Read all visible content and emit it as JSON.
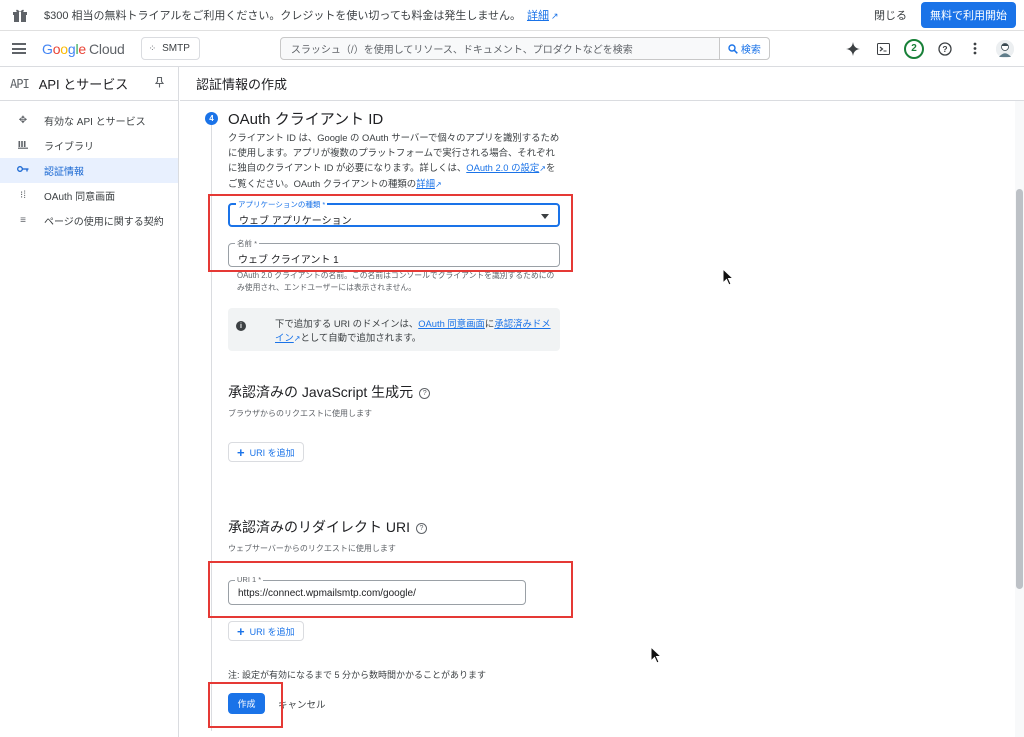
{
  "banner": {
    "message": "$300 相当の無料トライアルをご利用ください。クレジットを使い切っても料金は発生しません。",
    "detail_link": "詳細",
    "close": "閉じる",
    "trial_button": "無料で利用開始"
  },
  "header": {
    "logo_google": [
      "G",
      "o",
      "o",
      "g",
      "l",
      "e"
    ],
    "logo_cloud": "Cloud",
    "project": "SMTP",
    "search_placeholder": "スラッシュ（/）を使用してリソース、ドキュメント、プロダクトなどを検索",
    "search_button": "検索",
    "notification_count": "2"
  },
  "sidebar": {
    "api_badge": "API",
    "title": "API とサービス",
    "items": [
      {
        "label": "有効な API とサービス",
        "icon": "hub-icon"
      },
      {
        "label": "ライブラリ",
        "icon": "library-icon"
      },
      {
        "label": "認証情報",
        "icon": "key-icon"
      },
      {
        "label": "OAuth 同意画面",
        "icon": "consent-icon"
      },
      {
        "label": "ページの使用に関する契約",
        "icon": "agreement-icon"
      }
    ]
  },
  "main": {
    "page_title": "認証情報の作成",
    "step_number": "4",
    "oauth_heading": "OAuth クライアント ID",
    "description_before": "クライアント ID は、Google の OAuth サーバーで個々のアプリを識別するために使用します。アプリが複数のプラットフォームで実行される場合、それぞれに独自のクライアント ID が必要になります。詳しくは、",
    "description_link1": "OAuth 2.0 の設定",
    "description_mid": "をご覧ください。OAuth クライアントの種類の",
    "description_link2": "詳細",
    "app_type_label": "アプリケーションの種類 *",
    "app_type_value": "ウェブ アプリケーション",
    "name_label": "名前 *",
    "name_value": "ウェブ クライアント 1",
    "name_hint": "OAuth 2.0 クライアントの名前。この名前はコンソールでクライアントを識別するためにのみ使用され、エンドユーザーには表示されません。",
    "info_before": "下で追加する URI のドメインは、",
    "info_link1": "OAuth 同意画面",
    "info_mid": "に",
    "info_link2": "承認済みドメイン",
    "info_after": "として自動で追加されます。",
    "js_origins_title": "承認済みの JavaScript 生成元",
    "js_origins_sub": "ブラウザからのリクエストに使用します",
    "add_uri_1": "URI を追加",
    "redirect_title": "承認済みのリダイレクト URI",
    "redirect_sub": "ウェブサーバーからのリクエストに使用します",
    "uri1_label": "URI 1 *",
    "uri1_value": "https://connect.wpmailsmtp.com/google/",
    "add_uri_2": "URI を追加",
    "note": "注: 設定が有効になるまで 5 分から数時間かかることがあります",
    "create_button": "作成",
    "cancel_button": "キャンセル"
  },
  "colors": {
    "accent": "#1a73e8",
    "highlight_box": "#e53935",
    "active_nav_bg": "#e8f0fe"
  }
}
